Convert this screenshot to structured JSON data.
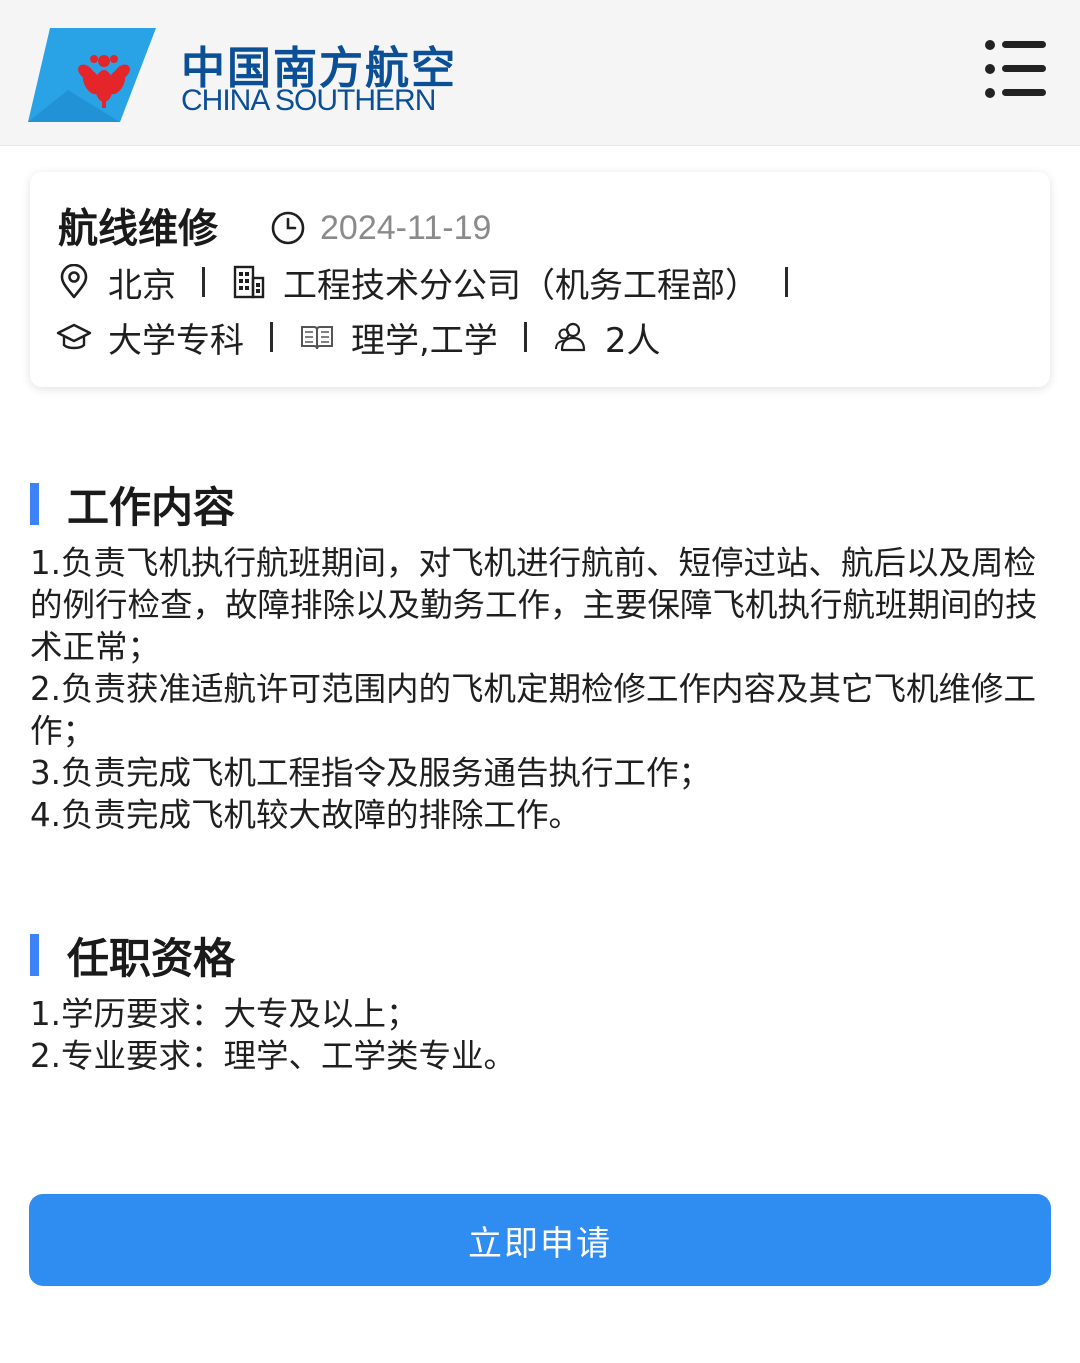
{
  "brand": {
    "name_cn": "中国南方航空",
    "name_en": "CHINA SOUTHERN",
    "logo_color": "#0b4f96",
    "accent_color": "#3e82f7",
    "button_color": "#2f8cf0"
  },
  "header": {
    "menu_icon": "list-menu-icon"
  },
  "job": {
    "title": "航线维修",
    "date": "2024-11-19",
    "location": "北京",
    "department": "工程技术分公司（机务工程部）",
    "education": "大学专科",
    "major": "理学,工学",
    "headcount": "2人"
  },
  "sections": {
    "duties": {
      "title": "工作内容",
      "lines": [
        "1.负责飞机执行航班期间，对飞机进行航前、短停过站、航后以及周检的例行检查，故障排除以及勤务工作，主要保障飞机执行航班期间的技术正常；",
        "2.负责获准适航许可范围内的飞机定期检修工作内容及其它飞机维修工作；",
        "3.负责完成飞机工程指令及服务通告执行工作；",
        "4.负责完成飞机较大故障的排除工作。"
      ]
    },
    "requirements": {
      "title": "任职资格",
      "lines": [
        "1.学历要求：大专及以上；",
        "2.专业要求：理学、工学类专业。"
      ]
    }
  },
  "actions": {
    "apply_label": "立即申请"
  }
}
